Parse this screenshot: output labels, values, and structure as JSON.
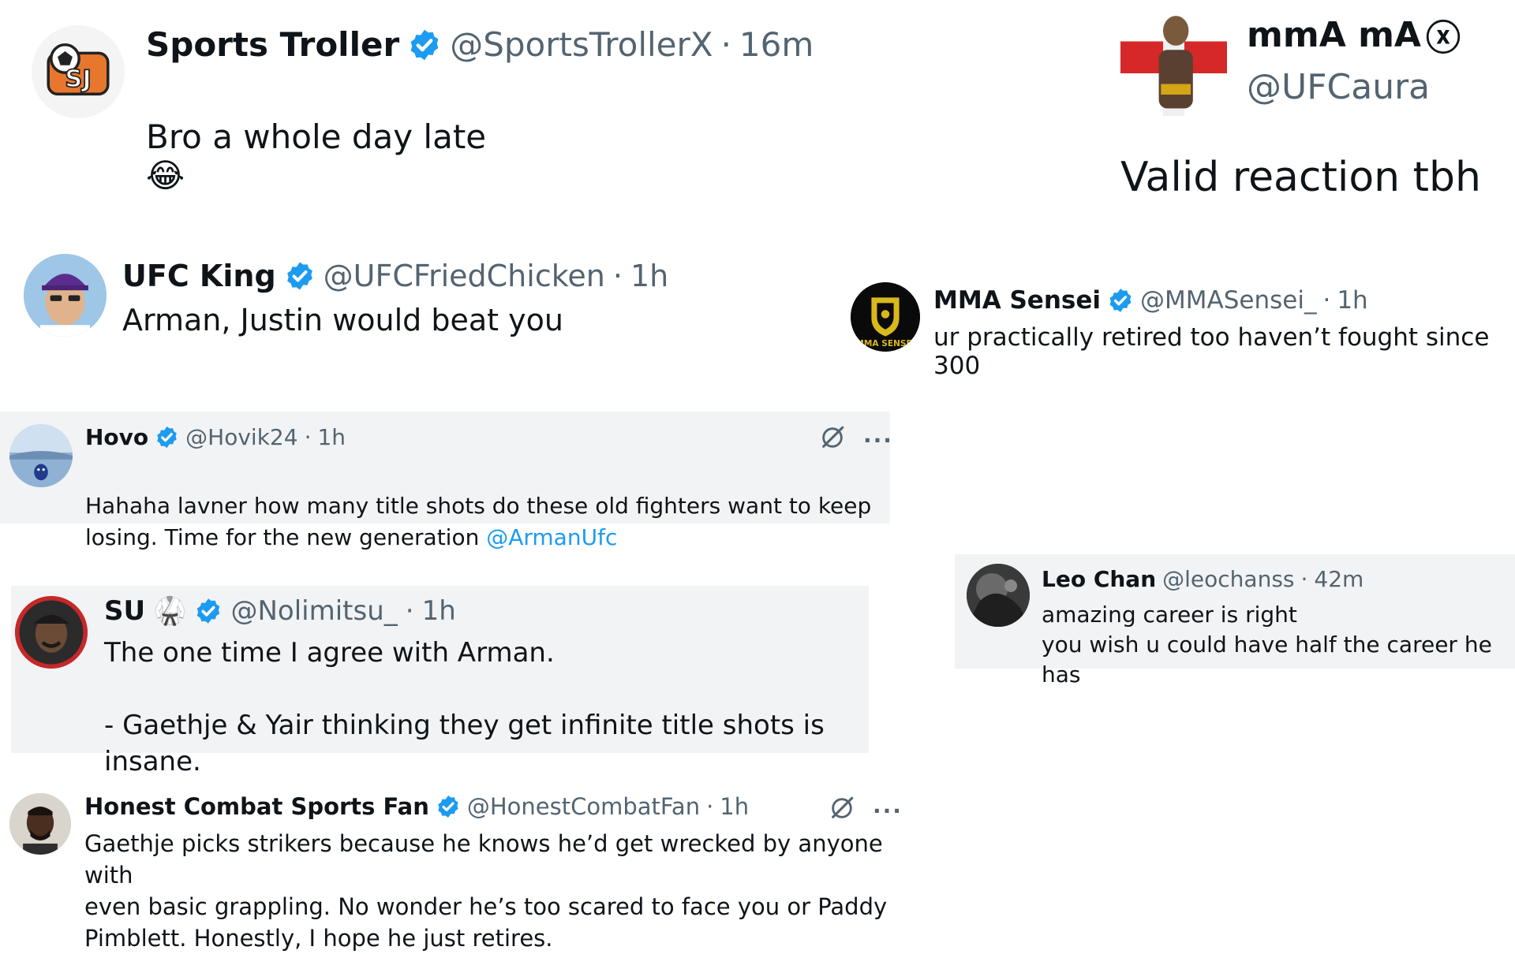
{
  "tweets": [
    {
      "name": "Sports Troller",
      "handle": "@SportsTrollerX",
      "time": "16m",
      "text": "Bro a whole day late",
      "emoji": "😂",
      "avatar_icon": "sports-troller-logo",
      "verified": true
    },
    {
      "name": "mmA mA",
      "name_suffix": "ⓧ",
      "handle": "@UFCaura",
      "text": "Valid reaction tbh",
      "avatar_icon": "fighter-flag-avatar",
      "verified": false
    },
    {
      "name": "UFC King",
      "handle": "@UFCFriedChicken",
      "time": "1h",
      "text": "Arman, Justin would beat you",
      "avatar_icon": "man-purple-cap-avatar",
      "verified": true
    },
    {
      "name": "MMA Sensei",
      "handle": "@MMASensei_",
      "time": "1h",
      "text": "ur practically retired too haven’t fought since 300",
      "avatar_icon": "mma-sensei-badge-logo",
      "avatar_text": "MMA SENSEI",
      "verified": true
    },
    {
      "name": "Hovo",
      "handle": "@Hovik24",
      "time": "1h",
      "text": "Hahaha lavner how many title shots do these old fighters want to keep\nlosing. Time for the new generation ",
      "mention": "@ArmanUfc",
      "avatar_icon": "bird-landscape-avatar",
      "verified": true
    },
    {
      "name": "Leo Chan",
      "handle": "@leochanss",
      "time": "42m",
      "text": "amazing career is right\nyou wish u could have half the career he has",
      "avatar_icon": "dark-photo-avatar",
      "verified": false
    },
    {
      "name": "SU",
      "name_suffix": "🥋",
      "handle": "@Nolimitsu_",
      "time": "1h",
      "text": "The one time I agree with Arman.\n\n- Gaethje & Yair thinking they get infinite title shots is insane.",
      "avatar_icon": "man-red-ring-avatar",
      "verified": true
    },
    {
      "name": "Honest Combat Sports Fan",
      "handle": "@HonestCombatFan",
      "time": "1h",
      "text": "Gaethje picks strikers because he knows he’d get wrecked by anyone with\neven basic grappling. No wonder he’s too scared to face you or Paddy\nPimblett. Honestly, I hope he just retires.",
      "avatar_icon": "man-portrait-avatar",
      "verified": true
    }
  ],
  "common": {
    "separator": "·",
    "more_label": "···",
    "grok_icon": "grok-icon"
  },
  "colors": {
    "verified_blue": "#1d9bf0",
    "link_blue": "#1d9bf0",
    "secondary_text": "#536471",
    "shaded_background": "#f2f3f5"
  }
}
